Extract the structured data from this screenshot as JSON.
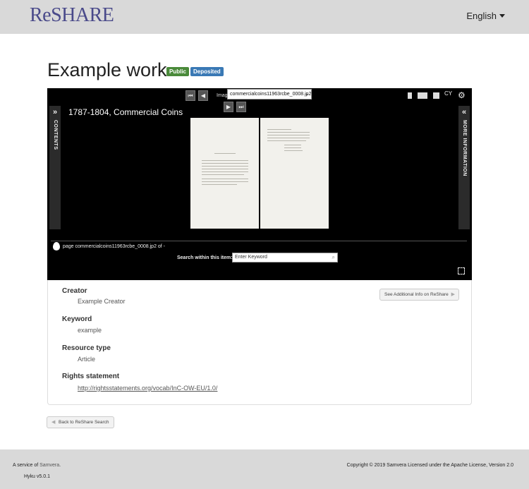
{
  "header": {
    "logo": "ReSHARE",
    "language": "English"
  },
  "work": {
    "title": "Example work",
    "badges": [
      "Public",
      "Deposited"
    ]
  },
  "viewer": {
    "image_label": "Image",
    "image_select_value": "commercialcoins11963rcbe_0008.jp2",
    "cy_label": "CY",
    "caption": "1787-1804, Commercial Coins",
    "left_panel_label": "CONTENTS",
    "right_panel_label": "MORE INFORMATION",
    "page_status": "page commercialcoins11963rcbe_0008.jp2 of -",
    "search_label": "Search within this item:",
    "search_placeholder": "Enter Keyword"
  },
  "metadata": {
    "additional_button": "See Additional Info on ReShare",
    "fields": [
      {
        "label": "Creator",
        "value": "Example Creator"
      },
      {
        "label": "Keyword",
        "value": "example"
      },
      {
        "label": "Resource type",
        "value": "Article"
      },
      {
        "label": "Rights statement",
        "value": "http://rightsstatements.org/vocab/InC-OW-EU/1.0/"
      }
    ]
  },
  "back_button": "Back to ReShare Search",
  "footer": {
    "service_prefix": "A service of",
    "service_link": "Samvera",
    "service_suffix": ".",
    "version": "Hyku v5.0.1",
    "copyright_prefix": "Copyright © 2019 Samvera",
    "copyright_suffix": "Licensed under the Apache License, Version 2.0"
  },
  "colors": {
    "header_bg": "#d9d9d9",
    "logo": "#4a4a8a",
    "public_badge": "#4a8a3a",
    "deposited_badge": "#3a79b5",
    "viewer_bg": "#000000"
  }
}
